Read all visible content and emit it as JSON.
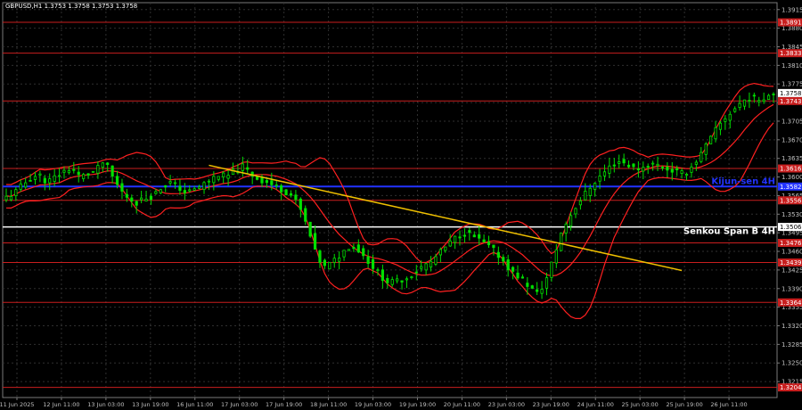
{
  "header": {
    "symbol_info": "GBPUSD,H1  1.3753 1.3758 1.3753 1.3758"
  },
  "colors": {
    "background": "#000000",
    "grid": "#2f2f2f",
    "candle_up": "#00e000",
    "candle_down": "#00e000",
    "bollinger": "#ff2020",
    "level_red": "#c81e1e",
    "kijun": "#2233ff",
    "senkou": "#ffffff",
    "trendline": "#f0c000",
    "axis_text": "#c0c0c0",
    "current_price_bg": "#ffffff",
    "level_label_bg": "#c81e1e"
  },
  "chart_data": {
    "type": "candlestick",
    "ylim": [
      1.3185,
      1.3928
    ],
    "y_ticks": [
      "1.3915",
      "1.3880",
      "1.3845",
      "1.3810",
      "1.3775",
      "1.3740",
      "1.3705",
      "1.3670",
      "1.3635",
      "1.3600",
      "1.3565",
      "1.3530",
      "1.3495",
      "1.3460",
      "1.3425",
      "1.3390",
      "1.3355",
      "1.3320",
      "1.3285",
      "1.3250",
      "1.3215"
    ],
    "x_ticks": [
      "11 Jun 2025",
      "12 Jun 11:00",
      "13 Jun 03:00",
      "13 Jun 19:00",
      "16 Jun 11:00",
      "17 Jun 03:00",
      "17 Jun 19:00",
      "18 Jun 11:00",
      "19 Jun 03:00",
      "19 Jun 19:00",
      "20 Jun 11:00",
      "23 Jun 03:00",
      "23 Jun 19:00",
      "24 Jun 11:00",
      "25 Jun 03:00",
      "25 Jun 19:00",
      "26 Jun 11:00"
    ],
    "close_series": [
      1.3562,
      1.357,
      1.3585,
      1.3598,
      1.3605,
      1.359,
      1.36,
      1.361,
      1.3618,
      1.36,
      1.3605,
      1.3612,
      1.363,
      1.36,
      1.3575,
      1.356,
      1.3552,
      1.356,
      1.3565,
      1.358,
      1.359,
      1.3582,
      1.357,
      1.3575,
      1.3585,
      1.3595,
      1.3605,
      1.36,
      1.3612,
      1.362,
      1.3605,
      1.3595,
      1.359,
      1.3582,
      1.3575,
      1.3565,
      1.354,
      1.35,
      1.345,
      1.343,
      1.344,
      1.3455,
      1.347,
      1.3465,
      1.3448,
      1.343,
      1.3412,
      1.34,
      1.3405,
      1.341,
      1.342,
      1.3432,
      1.344,
      1.3455,
      1.347,
      1.3485,
      1.3495,
      1.349,
      1.348,
      1.347,
      1.3458,
      1.344,
      1.342,
      1.341,
      1.3395,
      1.338,
      1.34,
      1.3445,
      1.3495,
      1.3525,
      1.355,
      1.357,
      1.359,
      1.3605,
      1.362,
      1.363,
      1.3625,
      1.3615,
      1.3618,
      1.3625,
      1.3622,
      1.3615,
      1.361,
      1.3605,
      1.362,
      1.364,
      1.3665,
      1.369,
      1.371,
      1.3725,
      1.374,
      1.375,
      1.3745,
      1.3752,
      1.3758
    ],
    "horizontal_levels": [
      {
        "label": "1.3891",
        "value": 1.3891,
        "style": "red"
      },
      {
        "label": "1.3833",
        "value": 1.3833,
        "style": "red"
      },
      {
        "label": "1.3743",
        "value": 1.3743,
        "style": "red"
      },
      {
        "label": "1.3616",
        "value": 1.3616,
        "style": "red"
      },
      {
        "label": "1.3556",
        "value": 1.3556,
        "style": "red"
      },
      {
        "label": "1.3476",
        "value": 1.3476,
        "style": "red"
      },
      {
        "label": "1.3439",
        "value": 1.3439,
        "style": "red"
      },
      {
        "label": "1.3364",
        "value": 1.3364,
        "style": "red"
      },
      {
        "label": "1.3204",
        "value": 1.3204,
        "style": "red"
      },
      {
        "label": "1.3582",
        "value": 1.3582,
        "style": "kijun"
      },
      {
        "label": "1.3506",
        "value": 1.3506,
        "style": "senkou"
      }
    ],
    "current_price": {
      "label": "1.3758",
      "value": 1.3758
    },
    "trendline": {
      "from": {
        "x_index": 42,
        "y": 1.3622
      },
      "to": {
        "x_index": 140,
        "y": 1.3424
      }
    },
    "annotations": [
      {
        "text": "Kijun-sen 4H",
        "level": 1.3582,
        "color": "#2233ff"
      },
      {
        "text": "Senkou Span B 4H",
        "level": 1.3488,
        "color": "#ffffff"
      }
    ]
  }
}
